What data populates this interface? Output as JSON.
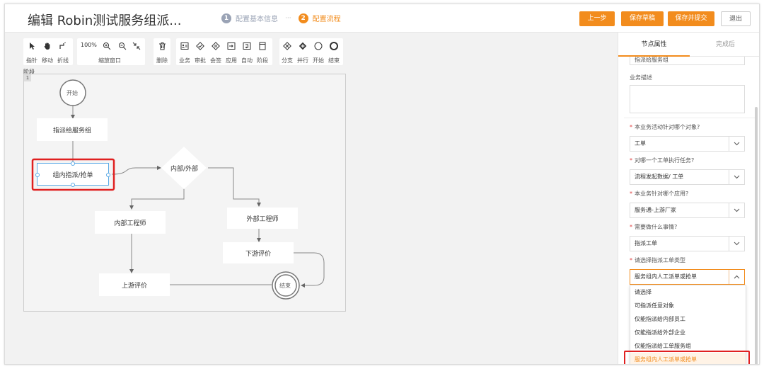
{
  "header": {
    "title": "编辑 Robin测试服务组派...",
    "steps": [
      {
        "num": "1",
        "label": "配置基本信息",
        "color": "#9aa3b5"
      },
      {
        "num": "2",
        "label": "配置流程",
        "color": "#f28c1d"
      }
    ],
    "step_separator": "···",
    "buttons": {
      "prev": "上一步",
      "save_draft": "保存草稿",
      "save_submit": "保存并提交",
      "exit": "退出"
    }
  },
  "toolbar": {
    "pointer": "指针",
    "move": "移动",
    "polyline": "折线",
    "zoom_value": "100%",
    "zoom_label": "缩放窗口",
    "delete": "删除",
    "business": "业务",
    "approve": "审批",
    "countersign": "会签",
    "application": "应用",
    "auto": "自动",
    "stage": "阶段",
    "branch": "分支",
    "parallel": "并行",
    "start": "开始",
    "end": "结束"
  },
  "canvas": {
    "label": "阶段",
    "badge": "1",
    "nodes": {
      "start": "开始",
      "assign_service_group": "指派给服务组",
      "group_grab": "组内指派/抢单",
      "internal_external": "内部/外部",
      "internal_engineer": "内部工程师",
      "external_engineer": "外部工程师",
      "downstream_review": "下游评价",
      "upstream_review": "上游评价",
      "end": "结束"
    }
  },
  "panel": {
    "tabs": {
      "active": "节点属性",
      "inactive": "完成后"
    },
    "top_input_value": "指派给服务组",
    "business_desc_label": "业务描述",
    "q1_label": "本业务活动针对哪个对象?",
    "q1_value": "工单",
    "q2_label": "对哪一个工单执行任务?",
    "q2_value": "流程发起数据/ 工单",
    "q3_label": "本业务针对哪个应用?",
    "q3_value": "服务通-上游厂家",
    "q4_label": "需要做什么事情?",
    "q4_value": "指派工单",
    "q5_label": "请选择指派工单类型",
    "q5_value": "服务组内人工派单或抢单",
    "options": [
      "请选择",
      "可指派任意对象",
      "仅能指派给内部员工",
      "仅能指派给外部企业",
      "仅能指派给工单服务组",
      "服务组内人工派单或抢单"
    ]
  },
  "colors": {
    "accent": "#f28c1d",
    "highlight": "#e02020",
    "selected_node": "#5aa9e6"
  }
}
